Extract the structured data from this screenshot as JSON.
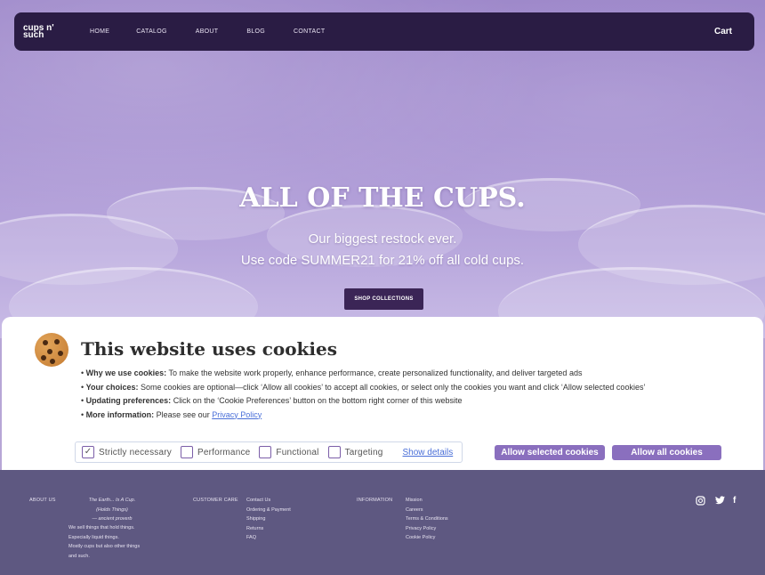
{
  "nav": {
    "logo": "cups n' such",
    "logo_line1": "cups n'",
    "logo_line2": "such",
    "links": [
      "HOME",
      "CATALOG",
      "ABOUT",
      "BLOG",
      "CONTACT"
    ],
    "cart": "Cart"
  },
  "hero": {
    "title": "ALL OF THE CUPS.",
    "subtitle_line1": "Our biggest restock ever.",
    "subtitle_line2": "Use code SUMMER21 for 21% off all cold cups.",
    "cta": "SHOP COLLECTIONS"
  },
  "cookie": {
    "icon": "cookie-icon",
    "title": "This website uses cookies",
    "items": [
      {
        "label": "Why we use cookies:",
        "text": " To make the website work properly, enhance performance, create personalized functionality, and deliver targeted ads"
      },
      {
        "label": "Your choices:",
        "text": " Some cookies are optional—click ‘Allow all cookies’ to accept all cookies, or select only the cookies you want and click ‘Allow selected cookies’"
      },
      {
        "label": "Updating preferences:",
        "text": " Click on the ‘Cookie Preferences’ button on the bottom right corner of this website"
      },
      {
        "label": "More information:",
        "text": " Please see our ",
        "link": "Privacy Policy"
      }
    ],
    "categories": [
      {
        "label": "Strictly necessary",
        "checked": true
      },
      {
        "label": "Performance",
        "checked": false
      },
      {
        "label": "Functional",
        "checked": false
      },
      {
        "label": "Targeting",
        "checked": false
      }
    ],
    "show_details": "Show details",
    "allow_selected": "Allow selected cookies",
    "allow_all": "Allow all cookies",
    "accent_color": "#8a6fbe"
  },
  "footer": {
    "about_heading": "ABOUT US",
    "quote_l1": "The Earth... Is A Cup.",
    "quote_l2": "(Holds Things)",
    "quote_l3": "— ancient proverb",
    "blurb_l1": "We sell things that hold things.",
    "blurb_l2": "Especially liquid things.",
    "blurb_l3": "Mostly cups but also other things",
    "blurb_l4": "and such.",
    "care_heading": "CUSTOMER CARE",
    "care_links": [
      "Contact Us",
      "Ordering & Payment",
      "Shipping",
      "Returns",
      "FAQ"
    ],
    "info_heading": "INFORMATION",
    "info_links": [
      "Mission",
      "Careers",
      "Terms & Conditions",
      "Privacy Policy",
      "Cookie Policy"
    ],
    "social_icons": [
      "instagram-icon",
      "twitter-icon",
      "facebook-icon"
    ]
  }
}
